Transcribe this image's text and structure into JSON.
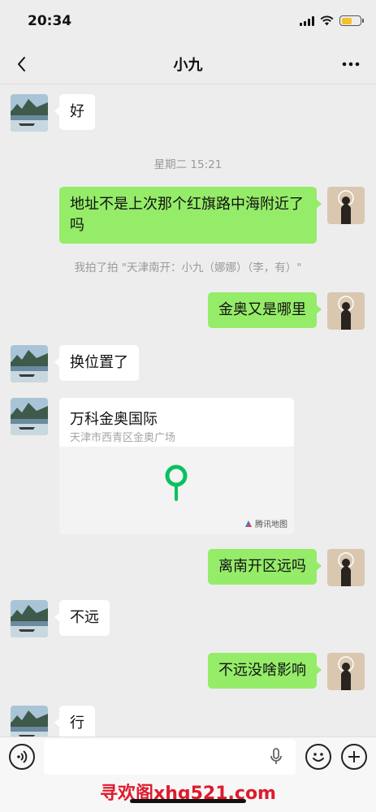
{
  "status": {
    "time": "20:34",
    "battery_color": "#f5c12b"
  },
  "header": {
    "title": "小九"
  },
  "messages": [
    {
      "type": "text",
      "side": "left",
      "text": "好"
    },
    {
      "type": "time",
      "text": "星期二 15:21"
    },
    {
      "type": "text",
      "side": "right",
      "text": "地址不是上次那个红旗路中海附近了吗"
    },
    {
      "type": "system",
      "text": "我拍了拍 \"天津南开：小九（娜娜）（李，有）\""
    },
    {
      "type": "text",
      "side": "right",
      "text": "金奥又是哪里"
    },
    {
      "type": "text",
      "side": "left",
      "text": "换位置了"
    },
    {
      "type": "location",
      "side": "left",
      "name": "万科金奥国际",
      "address": "天津市西青区金奥广场",
      "credit": "腾讯地图"
    },
    {
      "type": "text",
      "side": "right",
      "text": "离南开区远吗"
    },
    {
      "type": "text",
      "side": "left",
      "text": "不远"
    },
    {
      "type": "text",
      "side": "right",
      "text": "不远没啥影响"
    },
    {
      "type": "text",
      "side": "left",
      "text": "行"
    }
  ],
  "input": {
    "placeholder": ""
  },
  "watermark": "寻欢阁xhg521.com",
  "colors": {
    "bubble_right": "#95ec69",
    "bubble_left": "#ffffff",
    "background": "#ededed",
    "map_pin": "#07c160"
  }
}
